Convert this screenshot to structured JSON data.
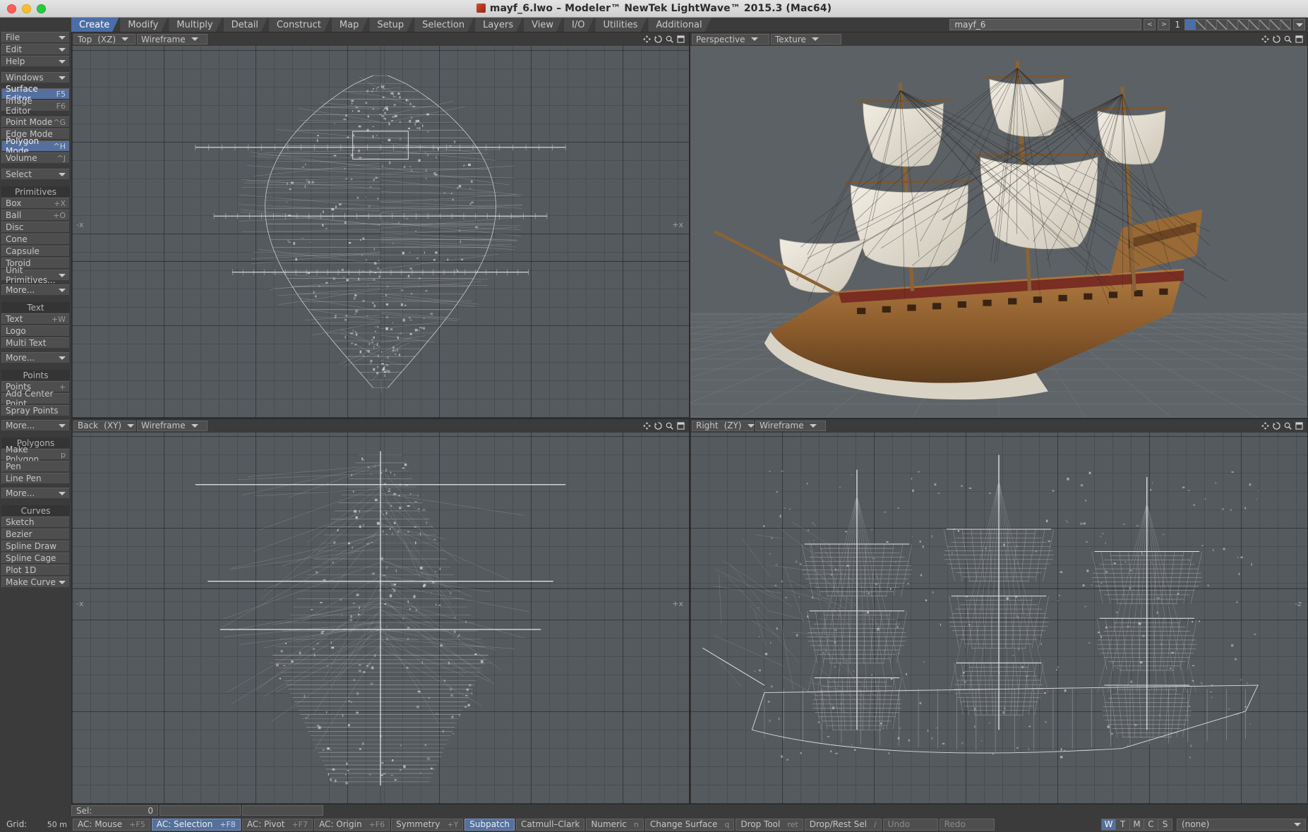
{
  "window": {
    "title": "mayf_6.lwo – Modeler™ NewTek LightWave™ 2015.3 (Mac64)",
    "doc_icon": "lightwave-object-icon"
  },
  "menu_tabs": [
    {
      "label": "Create",
      "active": true
    },
    {
      "label": "Modify",
      "active": false
    },
    {
      "label": "Multiply",
      "active": false
    },
    {
      "label": "Detail",
      "active": false
    },
    {
      "label": "Construct",
      "active": false
    },
    {
      "label": "Map",
      "active": false
    },
    {
      "label": "Setup",
      "active": false
    },
    {
      "label": "Selection",
      "active": false
    },
    {
      "label": "Layers",
      "active": false
    },
    {
      "label": "View",
      "active": false
    },
    {
      "label": "I/O",
      "active": false
    },
    {
      "label": "Utilities",
      "active": false
    },
    {
      "label": "Additional",
      "active": false
    }
  ],
  "layer_bank": {
    "object_name": "mayf_6",
    "current_layer": "1",
    "prev_label": "<",
    "next_label": ">",
    "cells": 10,
    "selected_cell_index": 0
  },
  "sidebar": {
    "menus": [
      {
        "label": "File",
        "type": "dropdown"
      },
      {
        "label": "Edit",
        "type": "dropdown"
      },
      {
        "label": "Help",
        "type": "dropdown"
      }
    ],
    "windows_menu": {
      "label": "Windows",
      "type": "dropdown"
    },
    "editors": [
      {
        "label": "Surface Editor",
        "key": "F5",
        "highlight": true
      },
      {
        "label": "Image Editor",
        "key": "F6",
        "highlight": false
      }
    ],
    "modes": [
      {
        "label": "Point Mode",
        "key": "^G",
        "highlight": false
      },
      {
        "label": "Edge Mode",
        "key": "",
        "highlight": false
      },
      {
        "label": "Polygon Mode",
        "key": "^H",
        "highlight": true
      },
      {
        "label": "Volume",
        "key": "^J",
        "highlight": false
      }
    ],
    "select_menu": {
      "label": "Select",
      "type": "dropdown"
    },
    "groups": [
      {
        "title": "Primitives",
        "items": [
          {
            "label": "Box",
            "key": "+X"
          },
          {
            "label": "Ball",
            "key": "+O"
          },
          {
            "label": "Disc",
            "key": ""
          },
          {
            "label": "Cone",
            "key": ""
          },
          {
            "label": "Capsule",
            "key": ""
          },
          {
            "label": "Toroid",
            "key": ""
          }
        ],
        "dropdowns": [
          {
            "label": "Unit Primitives..."
          },
          {
            "label": "More..."
          }
        ]
      },
      {
        "title": "Text",
        "items": [
          {
            "label": "Text",
            "key": "+W"
          },
          {
            "label": "Logo",
            "key": ""
          },
          {
            "label": "Multi Text",
            "key": ""
          }
        ],
        "dropdowns": [
          {
            "label": "More..."
          }
        ]
      },
      {
        "title": "Points",
        "items": [
          {
            "label": "Points",
            "key": "+"
          },
          {
            "label": "Add Center Point",
            "key": ""
          },
          {
            "label": "Spray Points",
            "key": ""
          }
        ],
        "dropdowns": [
          {
            "label": "More..."
          }
        ]
      },
      {
        "title": "Polygons",
        "items": [
          {
            "label": "Make Polygon",
            "key": "p"
          },
          {
            "label": "Pen",
            "key": ""
          },
          {
            "label": "Line Pen",
            "key": ""
          }
        ],
        "dropdowns": [
          {
            "label": "More..."
          }
        ]
      },
      {
        "title": "Curves",
        "items": [
          {
            "label": "Sketch",
            "key": ""
          },
          {
            "label": "Bezier",
            "key": ""
          },
          {
            "label": "Spline Draw",
            "key": ""
          },
          {
            "label": "Spline Cage",
            "key": ""
          },
          {
            "label": "Plot 1D",
            "key": ""
          }
        ],
        "dropdowns": [
          {
            "label": "Make Curve"
          }
        ]
      }
    ]
  },
  "viewports": [
    {
      "view": "Top",
      "axes": "(XZ)",
      "render": "Wireframe",
      "axis_labels": {
        "left": "-x",
        "right": "+x"
      },
      "icons": [
        "move-icon",
        "rotate-icon",
        "zoom-icon",
        "maximize-icon"
      ]
    },
    {
      "view": "Perspective",
      "axes": "",
      "render": "Texture",
      "axis_labels": {
        "left": "",
        "right": ""
      },
      "icons": [
        "move-icon",
        "rotate-icon",
        "zoom-icon",
        "maximize-icon"
      ]
    },
    {
      "view": "Back",
      "axes": "(XY)",
      "render": "Wireframe",
      "axis_labels": {
        "left": "-x",
        "right": "+x"
      },
      "icons": [
        "move-icon",
        "rotate-icon",
        "zoom-icon",
        "maximize-icon"
      ]
    },
    {
      "view": "Right",
      "axes": "(ZY)",
      "render": "Wireframe",
      "axis_labels": {
        "left": "",
        "right": "-z"
      },
      "icons": [
        "move-icon",
        "rotate-icon",
        "zoom-icon",
        "maximize-icon"
      ]
    }
  ],
  "selection_row": {
    "label": "Sel:",
    "value": "0"
  },
  "status_bar": {
    "grid_label": "Grid:",
    "grid_value": "50 m",
    "buttons": [
      {
        "label": "AC: Mouse",
        "key": "+F5",
        "highlight": false
      },
      {
        "label": "AC: Selection",
        "key": "+F8",
        "highlight": true
      },
      {
        "label": "AC: Pivot",
        "key": "+F7",
        "highlight": false
      },
      {
        "label": "AC: Origin",
        "key": "+F6",
        "highlight": false
      },
      {
        "label": "Symmetry",
        "key": "+Y",
        "highlight": false
      },
      {
        "label": "Subpatch",
        "key": "",
        "highlight": true
      },
      {
        "label": "Catmull–Clark",
        "key": "",
        "highlight": false
      },
      {
        "label": "Numeric",
        "key": "n",
        "highlight": false
      },
      {
        "label": "Change Surface",
        "key": "q",
        "highlight": false
      },
      {
        "label": "Drop Tool",
        "key": "ret",
        "highlight": false
      },
      {
        "label": "Drop/Rest Sel",
        "key": "/",
        "highlight": false
      },
      {
        "label": "Undo",
        "key": "",
        "highlight": false,
        "disabled": true
      },
      {
        "label": "Redo",
        "key": "",
        "highlight": false,
        "disabled": true
      }
    ],
    "display_modes": [
      {
        "label": "W",
        "on": true
      },
      {
        "label": "T",
        "on": false
      },
      {
        "label": "M",
        "on": false
      },
      {
        "label": "C",
        "on": false
      },
      {
        "label": "S",
        "on": false
      }
    ],
    "surface_selector": "(none)"
  }
}
